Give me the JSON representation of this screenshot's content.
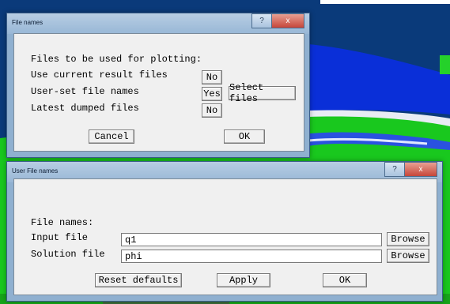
{
  "file_names_window": {
    "title": "File names",
    "help_btn": "?",
    "close_btn": "x",
    "heading": "Files to be used for plotting:",
    "rows": [
      {
        "label": "Use current result files",
        "value": "No"
      },
      {
        "label": "User-set file names",
        "value": "Yes"
      },
      {
        "label": "Latest dumped files",
        "value": "No"
      }
    ],
    "select_files": "Select files",
    "cancel": "Cancel",
    "ok": "OK"
  },
  "user_file_names_window": {
    "title": "User File names",
    "help_btn": "?",
    "close_btn": "x",
    "heading": "File names:",
    "input_label": "Input file",
    "input_value": "q1",
    "solution_label": "Solution file",
    "solution_value": "phi",
    "browse": "Browse",
    "reset": "Reset defaults",
    "apply": "Apply",
    "ok": "OK"
  },
  "colors": {
    "window_frame": "#8fb0d0",
    "client": "#f0f0f0",
    "close": "#c6463a",
    "background_blue": "#0a3a7a",
    "background_green": "#19c81e"
  }
}
